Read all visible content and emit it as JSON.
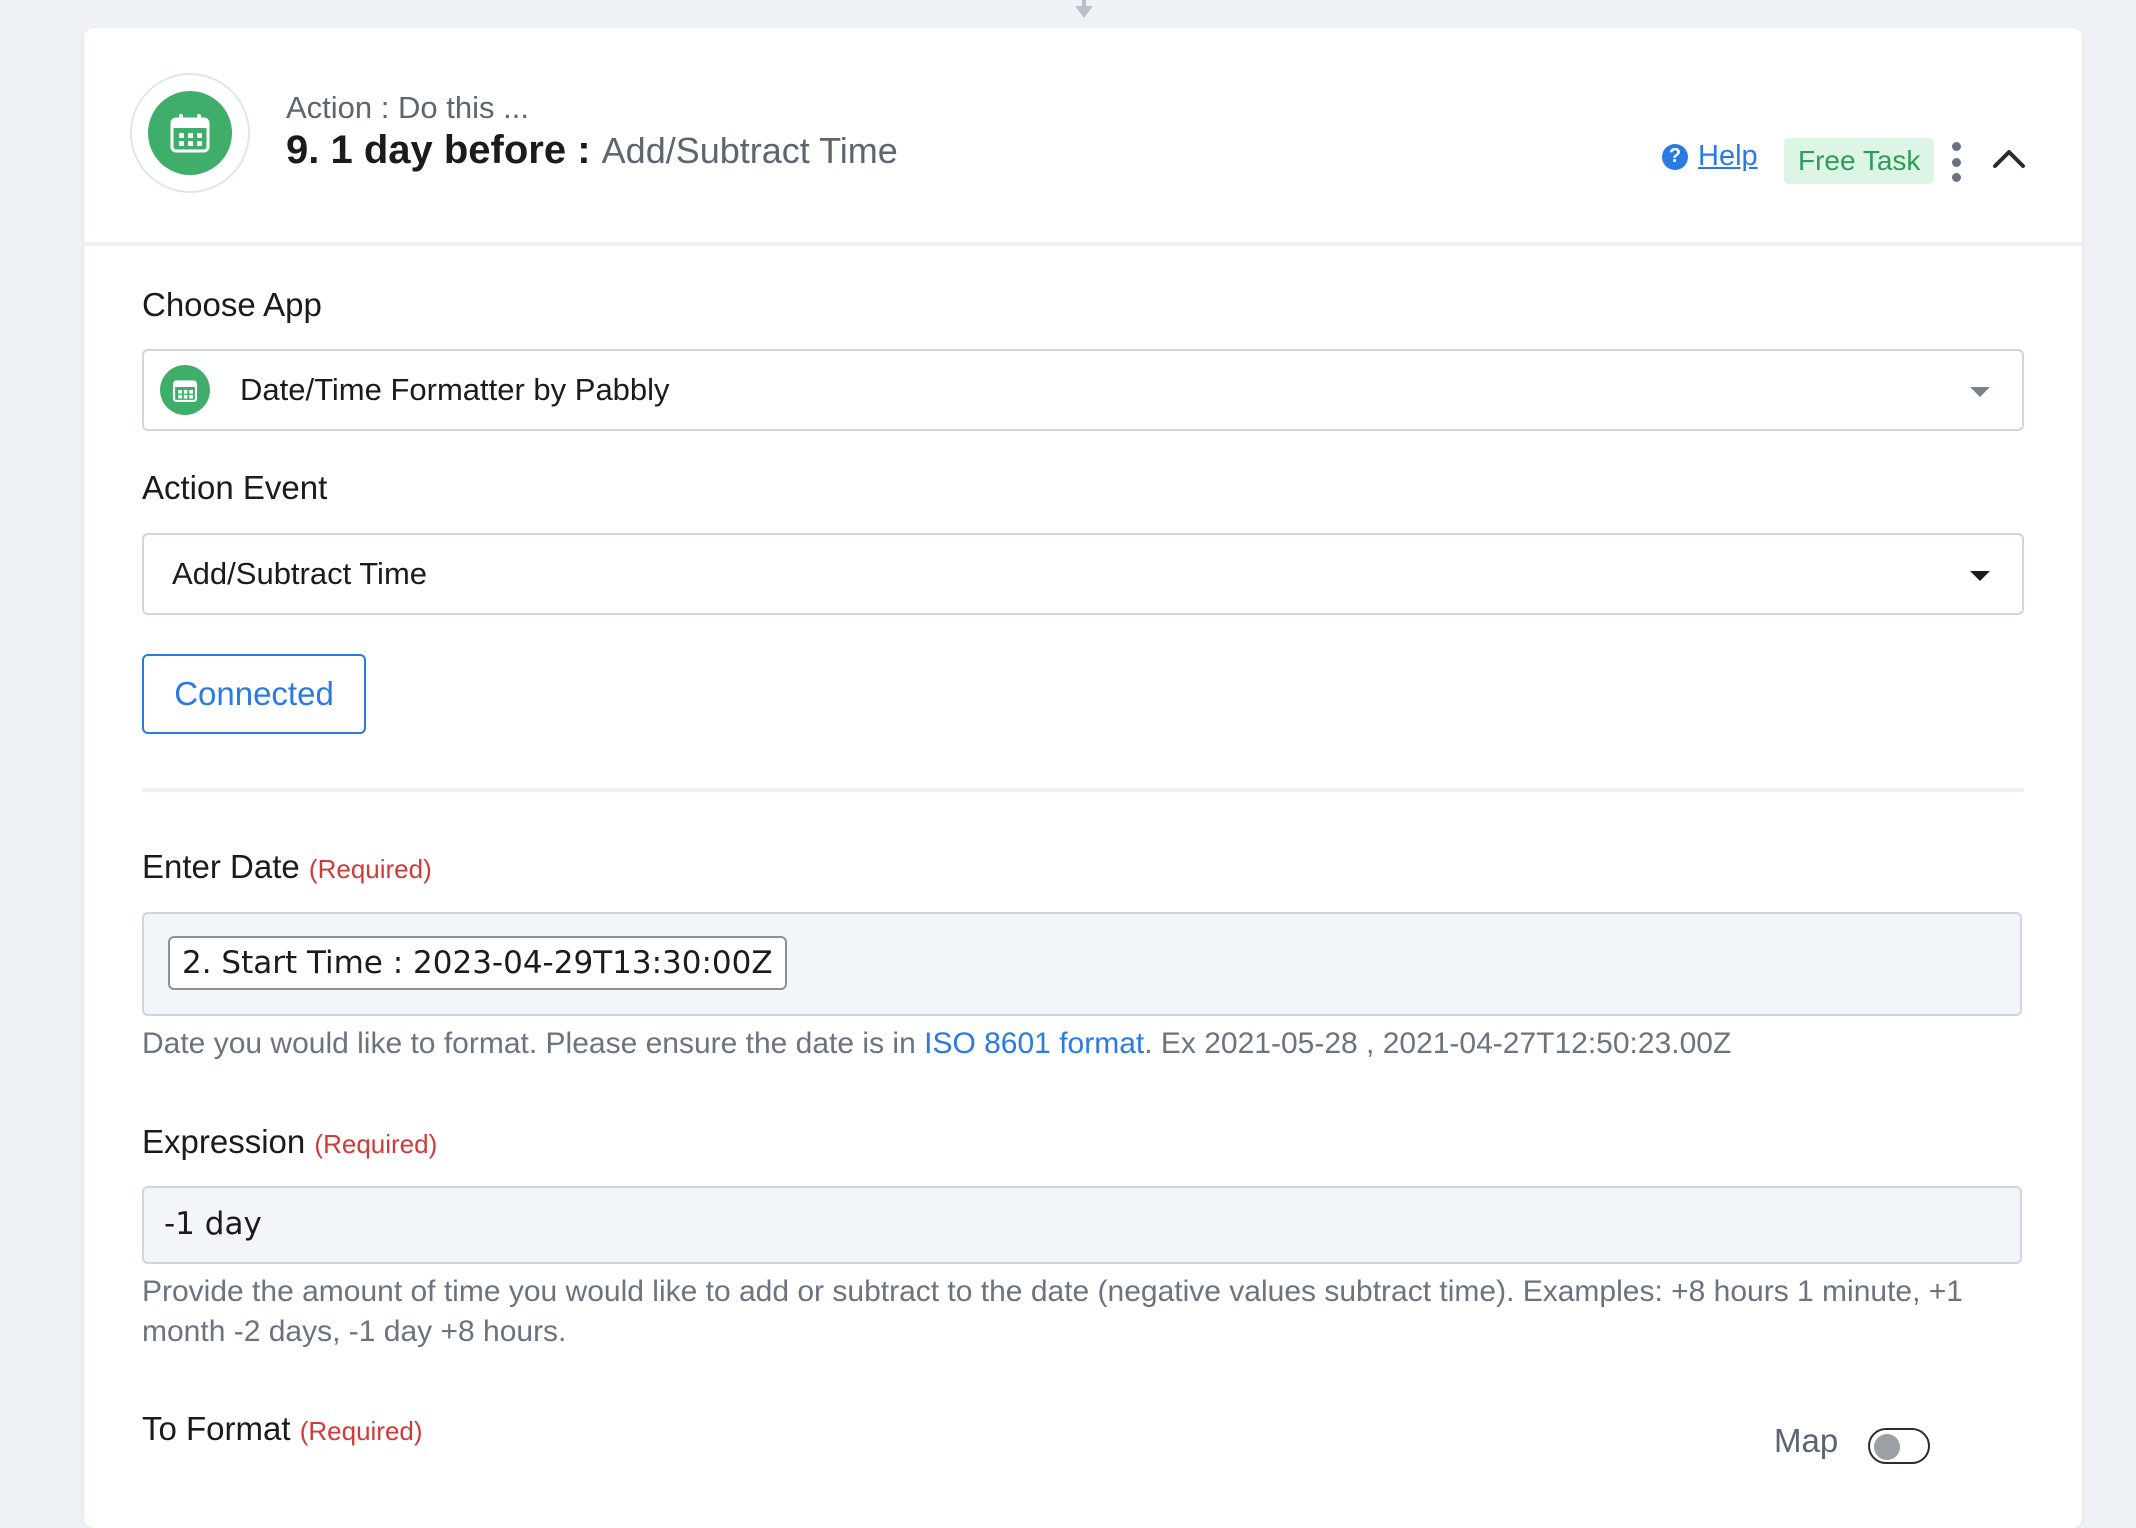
{
  "header": {
    "subtitle": "Action : Do this ...",
    "step_title": "9. 1 day before : ",
    "step_event": "Add/Subtract Time",
    "help_label": "Help",
    "badge_label": "Free Task"
  },
  "form": {
    "choose_app": {
      "label": "Choose App",
      "value": "Date/Time Formatter by Pabbly"
    },
    "action_event": {
      "label": "Action Event",
      "value": "Add/Subtract Time"
    },
    "connection_button_label": "Connected",
    "enter_date": {
      "label": "Enter Date",
      "required_label": "(Required)",
      "token_value": "2. Start Time : 2023-04-29T13:30:00Z",
      "help_before_link": "Date you would like to format. Please ensure the date is in ",
      "help_link": "ISO 8601 format",
      "help_after_link": ". Ex 2021-05-28 , 2021-04-27T12:50:23.00Z"
    },
    "expression": {
      "label": "Expression",
      "required_label": "(Required)",
      "value": "-1 day",
      "help": "Provide the amount of time you would like to add or subtract to the date (negative values subtract time). Examples: +8 hours 1 minute, +1 month -2 days, -1 day +8 hours."
    },
    "to_format": {
      "label": "To Format",
      "required_label": "(Required)",
      "map_label": "Map",
      "map_enabled": false
    }
  },
  "colors": {
    "accent": "#2a7ae4",
    "app_green": "#3fae6a",
    "required_red": "#d23a3a",
    "badge_bg": "#dcf5e5",
    "badge_text": "#2f9b5c"
  },
  "icons": {
    "app": "calendar-icon",
    "help": "question-circle-icon",
    "menu": "kebab-menu-icon",
    "collapse": "chevron-up-icon",
    "connector": "arrow-down-icon"
  }
}
